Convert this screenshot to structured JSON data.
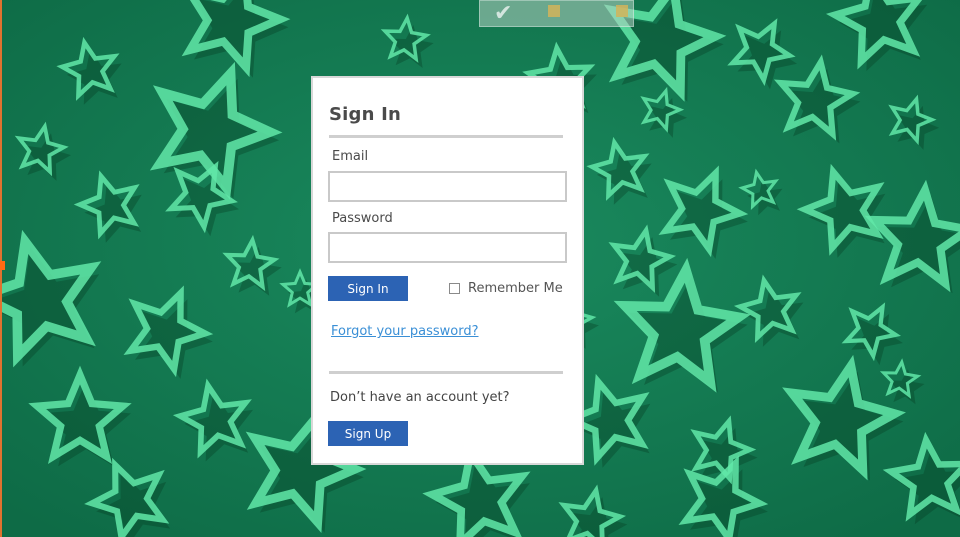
{
  "login": {
    "title": "Sign In",
    "email_label": "Email",
    "email_value": "",
    "password_label": "Password",
    "password_value": "",
    "sign_in_button": "Sign In",
    "remember_me_label": "Remember Me",
    "remember_me_checked": false,
    "forgot_password_link": "Forgot your password?",
    "no_account_text": "Don’t have an account yet?",
    "sign_up_button": "Sign Up"
  },
  "icons": {
    "remember_checkbox": "checkbox-icon",
    "top_logo": "logo-icon"
  },
  "colors": {
    "background_dark": "#157a55",
    "background_star": "#62e8a8",
    "button_blue": "#2c63b4",
    "link_blue": "#3a8fd6",
    "rule_gray": "#cfcfcf",
    "edge_orange": "#ff6a13"
  }
}
